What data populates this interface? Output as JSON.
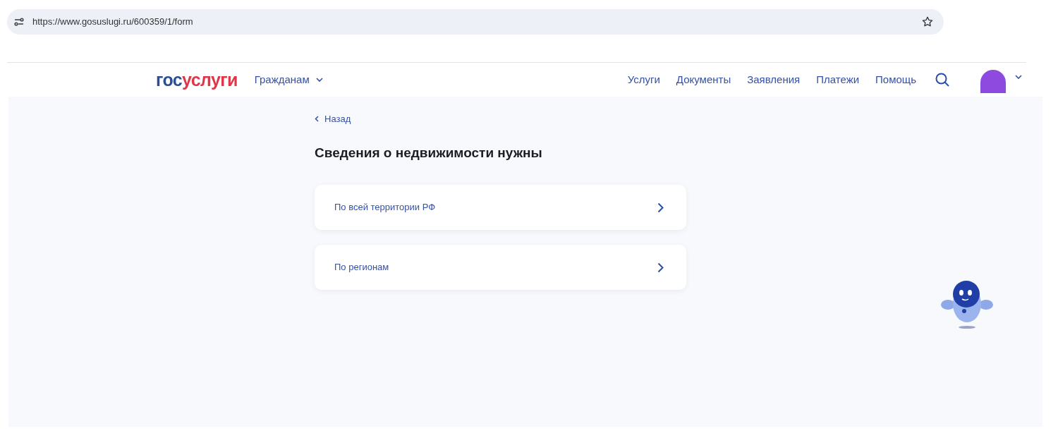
{
  "browser": {
    "url": "https://www.gosuslugi.ru/600359/1/form"
  },
  "header": {
    "logo": [
      "гос",
      "услуги"
    ],
    "audience": "Гражданам",
    "nav": [
      "Услуги",
      "Документы",
      "Заявления",
      "Платежи",
      "Помощь"
    ]
  },
  "back": "Назад",
  "title": "Сведения о недвижимости нужны",
  "options": [
    {
      "label": "По всей территории РФ"
    },
    {
      "label": "По регионам"
    }
  ]
}
